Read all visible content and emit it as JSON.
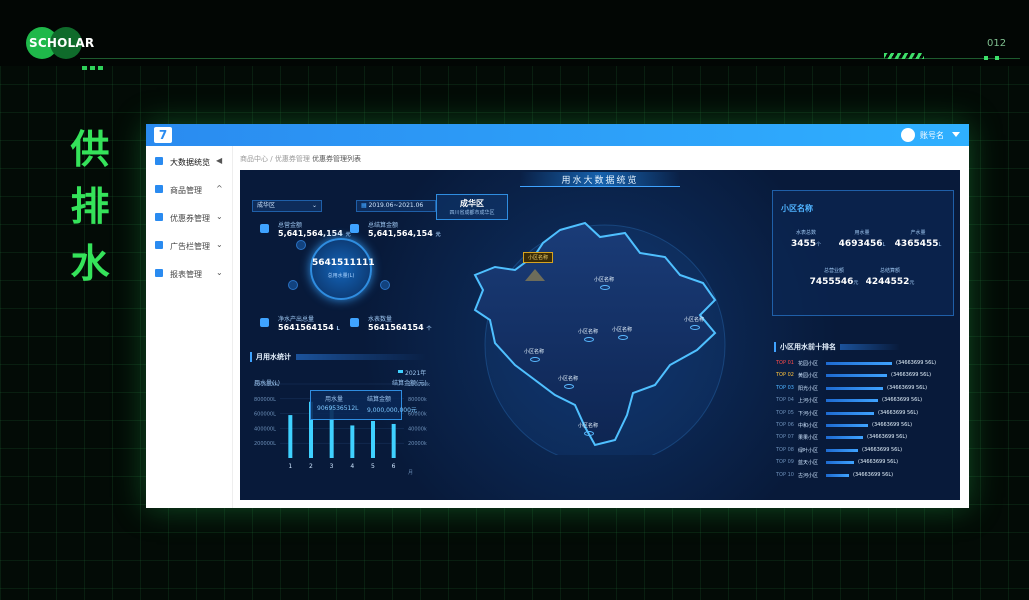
{
  "slide": {
    "logo_text": "SCHOLAR",
    "page_number": "012",
    "vertical_title": [
      "供",
      "排",
      "水"
    ]
  },
  "app": {
    "user_name": "账号名",
    "sidebar": [
      {
        "label": "大数据统览",
        "icon": "dashboard-icon",
        "arrow": "◀"
      },
      {
        "label": "商品管理",
        "icon": "goods-icon",
        "arrow": "^"
      },
      {
        "label": "优惠券管理",
        "icon": "coupon-icon",
        "arrow": "⌄"
      },
      {
        "label": "广告栏管理",
        "icon": "ad-icon",
        "arrow": "⌄"
      },
      {
        "label": "报表管理",
        "icon": "report-icon",
        "arrow": "⌄"
      }
    ],
    "breadcrumb": {
      "home": "商品中心",
      "sep": "/",
      "mid": "优惠券管理",
      "current": "优惠券管理列表"
    }
  },
  "dashboard": {
    "title": "用水大数据统览",
    "district_select": "成华区",
    "date_range": "2019.06~2021.06",
    "metrics": {
      "total_amount_label": "总营金额",
      "total_amount_value": "5,641,564,154",
      "total_amount_unit": "元",
      "total_bill_label": "总结算金额",
      "total_bill_value": "5,641,564,154",
      "total_bill_unit": "元",
      "total_water_value": "5641511111",
      "total_water_label": "总用水量(L)",
      "clean_water_label": "净水产出总量",
      "clean_water_value": "5641564154",
      "clean_water_unit": "L",
      "meter_label": "水表数量",
      "meter_value": "5641564154",
      "meter_unit": "个"
    },
    "area": {
      "name": "成华区",
      "desc": "四川省成都市成华区"
    },
    "map_pin": "小区名称",
    "map_labels": [
      "小区名称",
      "小区名称",
      "小区名称",
      "小区名称",
      "小区名称",
      "小区名称",
      "小区名称"
    ],
    "card": {
      "title": "小区名称",
      "stats": [
        {
          "label": "水表总数",
          "value": "3455",
          "unit": "个"
        },
        {
          "label": "用水量",
          "value": "4693456",
          "unit": "L"
        },
        {
          "label": "产水量",
          "value": "4365455",
          "unit": "L"
        },
        {
          "label": "总营业额",
          "value": "7455546",
          "unit": "元"
        },
        {
          "label": "总结算额",
          "value": "4244552",
          "unit": "元"
        }
      ]
    },
    "ranking": {
      "title": "小区用水前十排名",
      "rows": [
        {
          "no": "TOP 01",
          "name": "花园小区",
          "value": "(34663699 56L)",
          "pct": 1.0,
          "color": "#ff4b4b"
        },
        {
          "no": "TOP 02",
          "name": "黄园小区",
          "value": "(34663699 56L)",
          "pct": 0.93,
          "color": "#ffc23d"
        },
        {
          "no": "TOP 03",
          "name": "阳光小区",
          "value": "(34663699 56L)",
          "pct": 0.86,
          "color": "#4fb3ff"
        },
        {
          "no": "TOP 04",
          "name": "上河小区",
          "value": "(34663699 56L)",
          "pct": 0.79,
          "color": "#6c8fb8"
        },
        {
          "no": "TOP 05",
          "name": "下河小区",
          "value": "(34663699 56L)",
          "pct": 0.72,
          "color": "#6c8fb8"
        },
        {
          "no": "TOP 06",
          "name": "中和小区",
          "value": "(34663699 56L)",
          "pct": 0.63,
          "color": "#6c8fb8"
        },
        {
          "no": "TOP 07",
          "name": "果果小区",
          "value": "(34663699 56L)",
          "pct": 0.56,
          "color": "#6c8fb8"
        },
        {
          "no": "TOP 08",
          "name": "绿叶小区",
          "value": "(34663699 56L)",
          "pct": 0.49,
          "color": "#6c8fb8"
        },
        {
          "no": "TOP 09",
          "name": "蓝天小区",
          "value": "(34663699 56L)",
          "pct": 0.42,
          "color": "#6c8fb8"
        },
        {
          "no": "TOP 10",
          "name": "古河小区",
          "value": "(34663699 56L)",
          "pct": 0.35,
          "color": "#6c8fb8"
        }
      ]
    },
    "monthly_title": "月用水统计",
    "tooltip": {
      "water_label": "用水量",
      "water_value": "9069536512L",
      "bill_label": "结算金额",
      "bill_value": "9,000,000,000元"
    }
  },
  "chart_data": {
    "type": "bar",
    "title": "月用水统计",
    "legend": "2021年",
    "ylabel": "用水量(L)",
    "y2label": "结算金额(元)",
    "xlabel": "月",
    "categories": [
      "1",
      "2",
      "3",
      "4",
      "5",
      "6"
    ],
    "values": [
      580000,
      760000,
      710000,
      440000,
      500000,
      460000
    ],
    "ylim": [
      0,
      1000000
    ],
    "y_ticks": [
      "1000000L",
      "800000L",
      "600000L",
      "400000L",
      "200000L"
    ],
    "y2_ticks": [
      "100000k",
      "80000k",
      "60000k",
      "40000k",
      "20000k"
    ]
  }
}
